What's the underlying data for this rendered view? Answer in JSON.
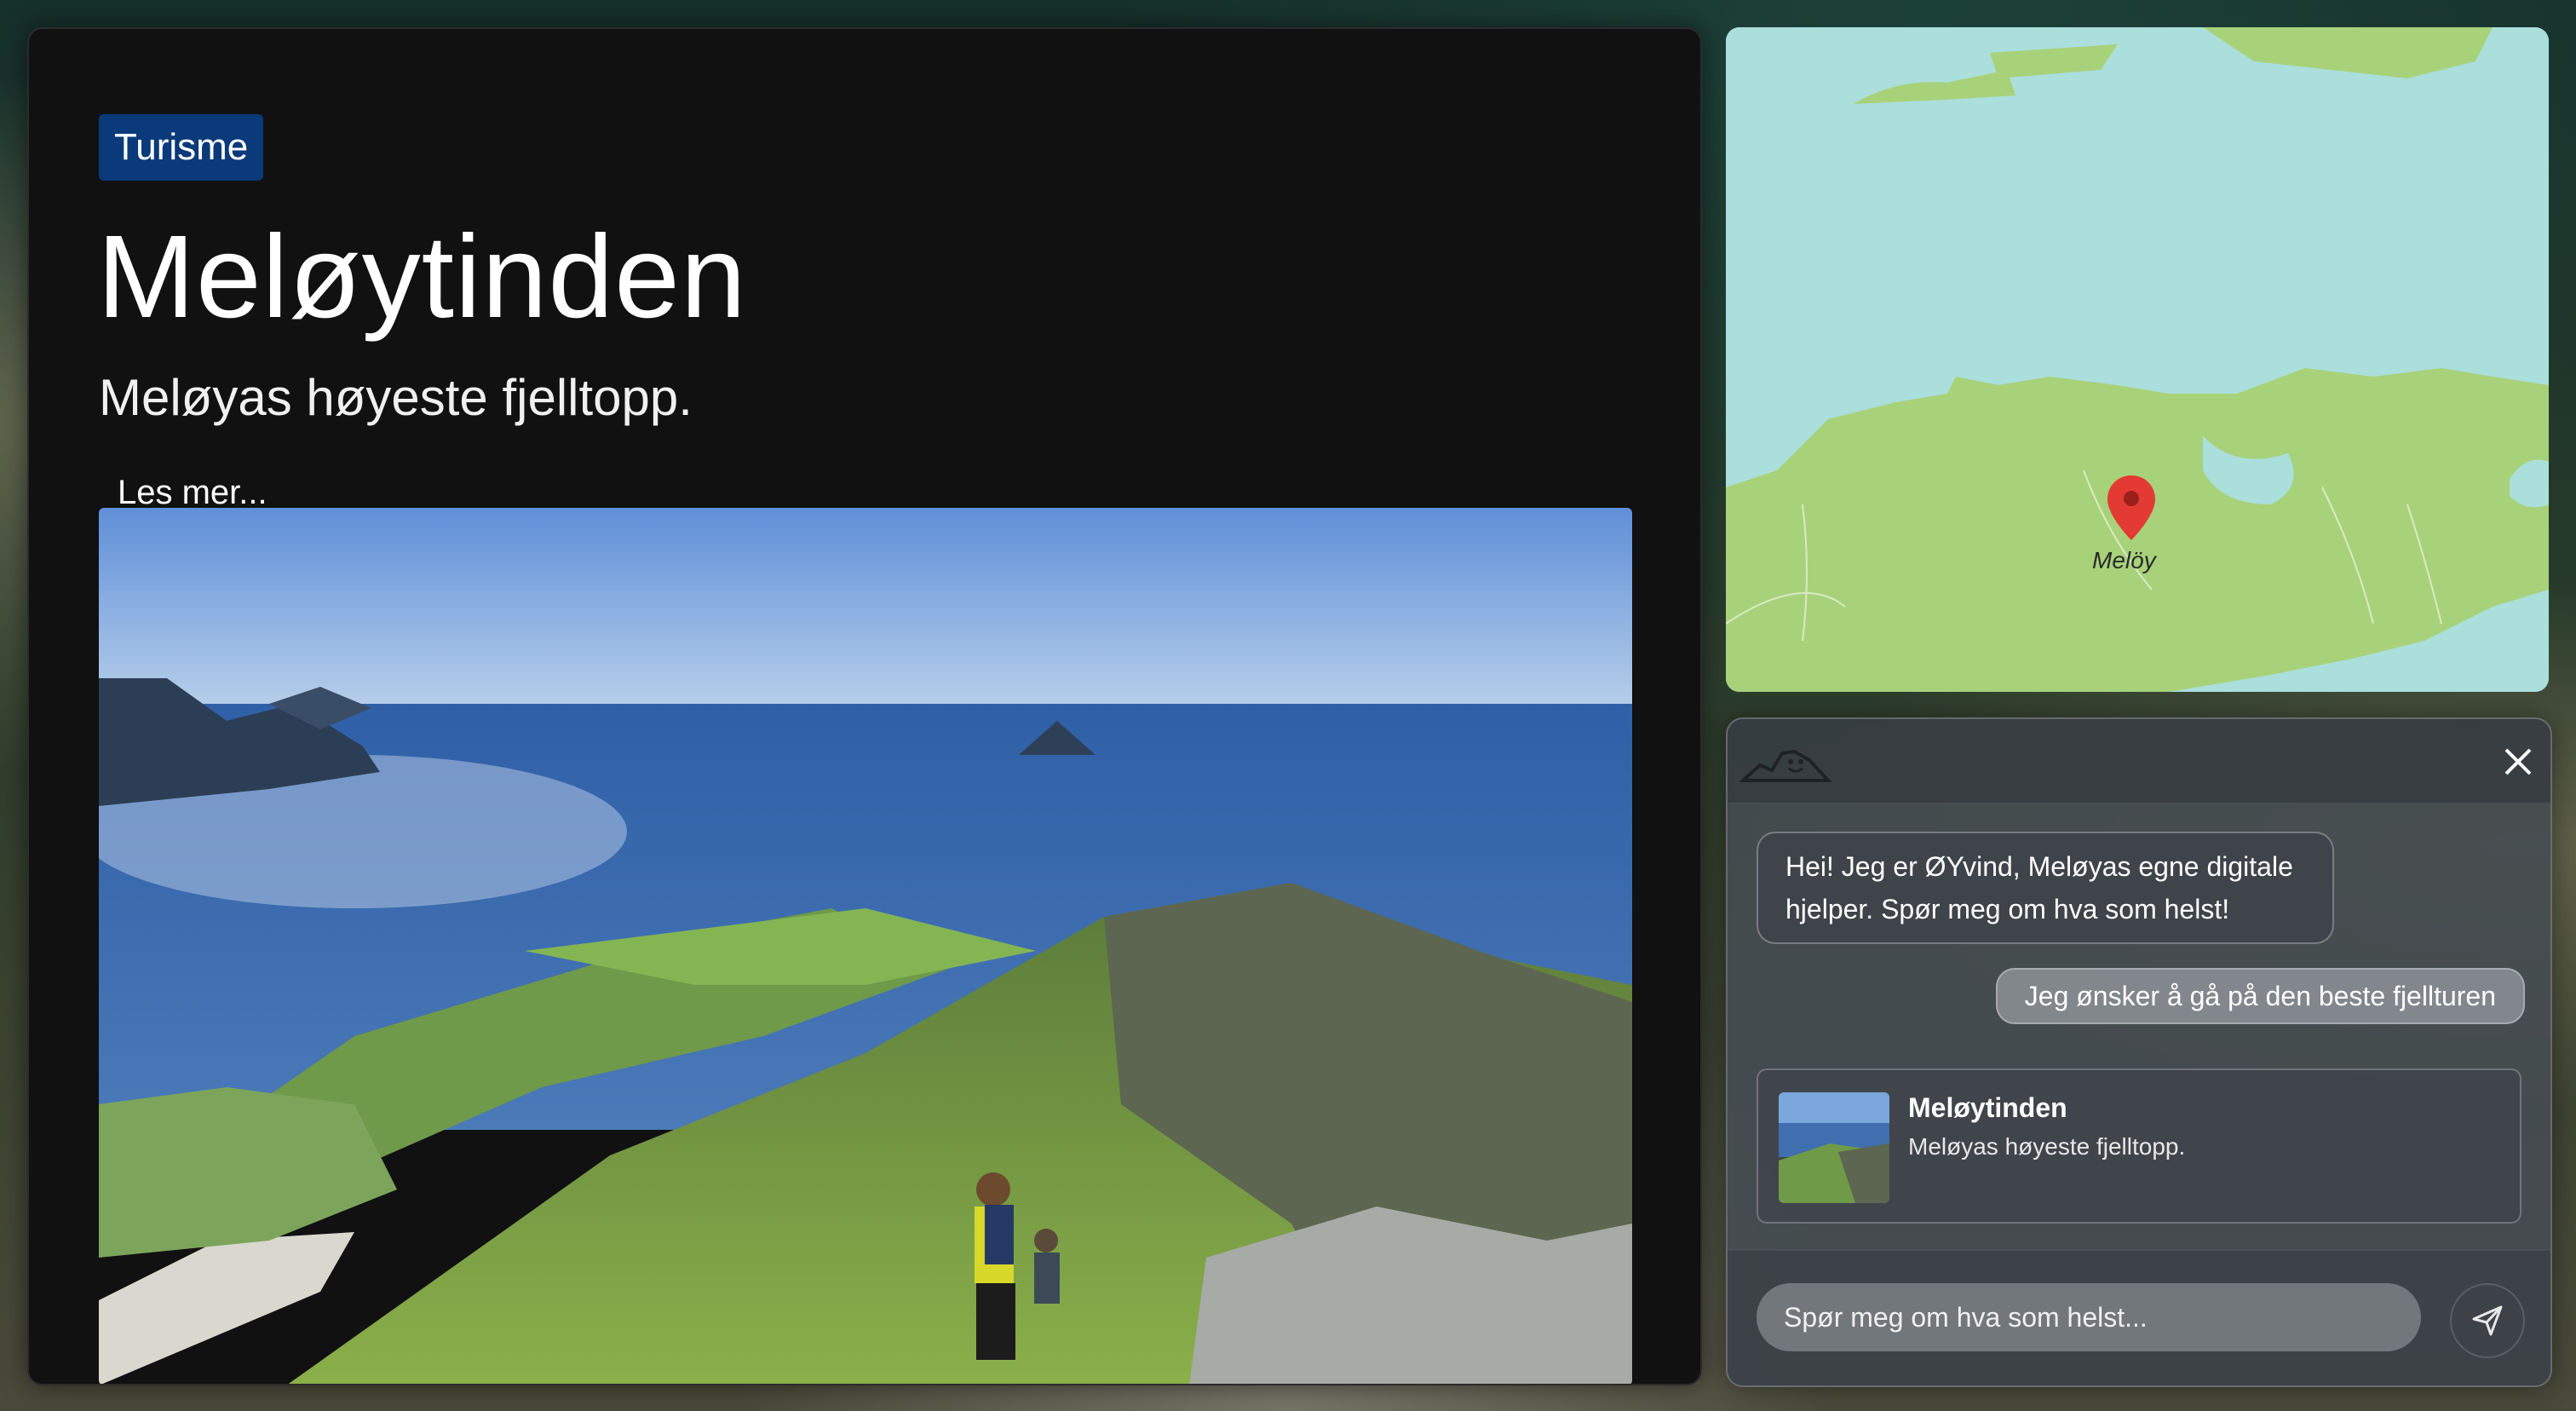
{
  "article": {
    "category": "Turisme",
    "title": "Meløytinden",
    "subtitle": "Meløyas høyeste fjelltopp.",
    "read_more": "Les mer...",
    "image_alt": "Hikers on Meløytinden overlooking the sea and islands"
  },
  "map": {
    "marker_label": "Melöy",
    "colors": {
      "water": "#aadfdb",
      "land": "#a8d27a"
    }
  },
  "chat": {
    "logo": "mountain-face-logo",
    "messages": [
      {
        "role": "bot",
        "text": "Hei! Jeg er ØYvind, Meløyas egne digitale hjelper. Spør meg om hva som helst!"
      },
      {
        "role": "user",
        "text": "Jeg ønsker å gå på den beste fjellturen"
      }
    ],
    "card": {
      "title": "Meløytinden",
      "subtitle": "Meløyas høyeste fjelltopp."
    },
    "input_placeholder": "Spør meg om hva som helst...",
    "input_value": ""
  },
  "colors": {
    "badge": "#0b3a7a",
    "panel": "#111111"
  }
}
